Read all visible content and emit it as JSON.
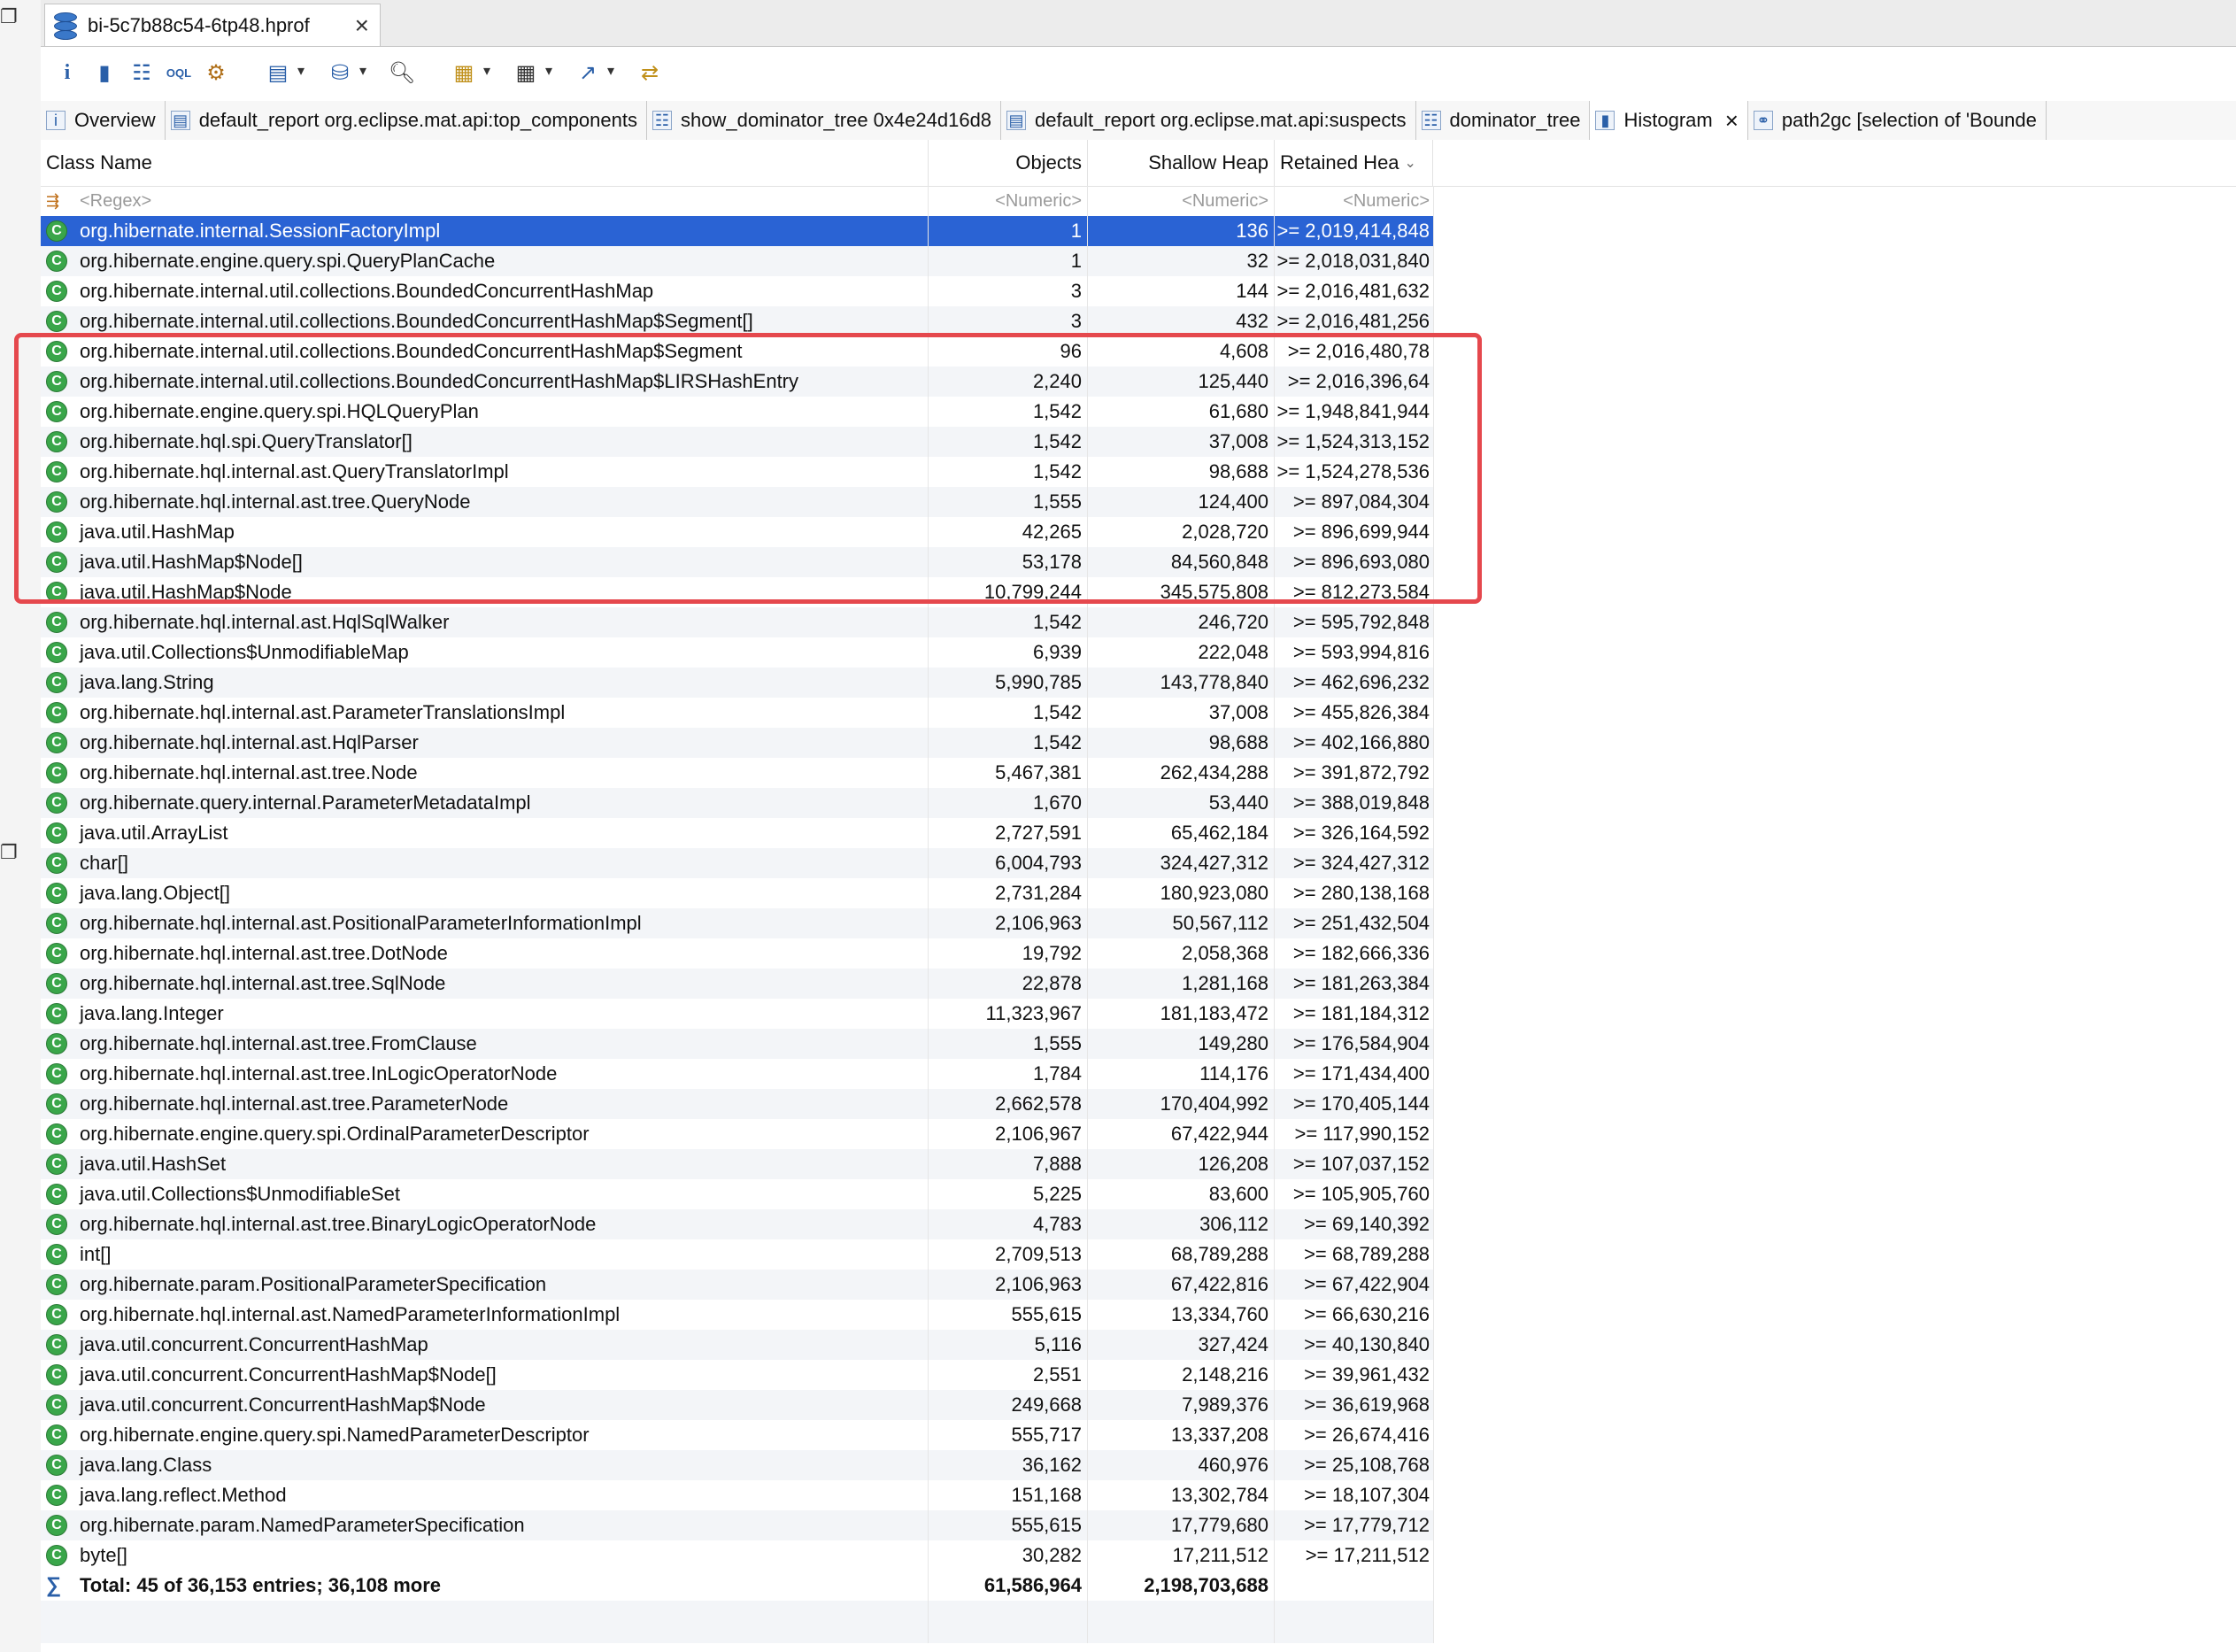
{
  "file_tab": {
    "title": "bi-5c7b88c54-6tp48.hprof"
  },
  "view_tabs": [
    {
      "label": "Overview",
      "icon": "info-icon"
    },
    {
      "label": "default_report org.eclipse.mat.api:top_components",
      "icon": "report-icon"
    },
    {
      "label": "show_dominator_tree 0x4e24d16d8",
      "icon": "tree-icon"
    },
    {
      "label": "default_report org.eclipse.mat.api:suspects",
      "icon": "report-icon"
    },
    {
      "label": "dominator_tree",
      "icon": "tree-icon"
    },
    {
      "label": "Histogram",
      "icon": "histogram-icon",
      "active": true
    },
    {
      "label": "path2gc [selection of 'Bounde",
      "icon": "path-icon"
    }
  ],
  "columns": {
    "class_name": "Class Name",
    "objects": "Objects",
    "shallow_heap": "Shallow Heap",
    "retained_heap": "Retained Hea"
  },
  "filter_row": {
    "name": "<Regex>",
    "objects": "<Numeric>",
    "shallow": "<Numeric>",
    "retained": "<Numeric>"
  },
  "rows": [
    [
      "org.hibernate.internal.SessionFactoryImpl",
      "1",
      "136",
      ">= 2,019,414,848"
    ],
    [
      "org.hibernate.engine.query.spi.QueryPlanCache",
      "1",
      "32",
      ">= 2,018,031,840"
    ],
    [
      "org.hibernate.internal.util.collections.BoundedConcurrentHashMap",
      "3",
      "144",
      ">= 2,016,481,632"
    ],
    [
      "org.hibernate.internal.util.collections.BoundedConcurrentHashMap$Segment[]",
      "3",
      "432",
      ">= 2,016,481,256"
    ],
    [
      "org.hibernate.internal.util.collections.BoundedConcurrentHashMap$Segment",
      "96",
      "4,608",
      ">= 2,016,480,78"
    ],
    [
      "org.hibernate.internal.util.collections.BoundedConcurrentHashMap$LIRSHashEntry",
      "2,240",
      "125,440",
      ">= 2,016,396,64"
    ],
    [
      "org.hibernate.engine.query.spi.HQLQueryPlan",
      "1,542",
      "61,680",
      ">= 1,948,841,944"
    ],
    [
      "org.hibernate.hql.spi.QueryTranslator[]",
      "1,542",
      "37,008",
      ">= 1,524,313,152"
    ],
    [
      "org.hibernate.hql.internal.ast.QueryTranslatorImpl",
      "1,542",
      "98,688",
      ">= 1,524,278,536"
    ],
    [
      "org.hibernate.hql.internal.ast.tree.QueryNode",
      "1,555",
      "124,400",
      ">= 897,084,304"
    ],
    [
      "java.util.HashMap",
      "42,265",
      "2,028,720",
      ">= 896,699,944"
    ],
    [
      "java.util.HashMap$Node[]",
      "53,178",
      "84,560,848",
      ">= 896,693,080"
    ],
    [
      "java.util.HashMap$Node",
      "10,799,244",
      "345,575,808",
      ">= 812,273,584"
    ],
    [
      "org.hibernate.hql.internal.ast.HqlSqlWalker",
      "1,542",
      "246,720",
      ">= 595,792,848"
    ],
    [
      "java.util.Collections$UnmodifiableMap",
      "6,939",
      "222,048",
      ">= 593,994,816"
    ],
    [
      "java.lang.String",
      "5,990,785",
      "143,778,840",
      ">= 462,696,232"
    ],
    [
      "org.hibernate.hql.internal.ast.ParameterTranslationsImpl",
      "1,542",
      "37,008",
      ">= 455,826,384"
    ],
    [
      "org.hibernate.hql.internal.ast.HqlParser",
      "1,542",
      "98,688",
      ">= 402,166,880"
    ],
    [
      "org.hibernate.hql.internal.ast.tree.Node",
      "5,467,381",
      "262,434,288",
      ">= 391,872,792"
    ],
    [
      "org.hibernate.query.internal.ParameterMetadataImpl",
      "1,670",
      "53,440",
      ">= 388,019,848"
    ],
    [
      "java.util.ArrayList",
      "2,727,591",
      "65,462,184",
      ">= 326,164,592"
    ],
    [
      "char[]",
      "6,004,793",
      "324,427,312",
      ">= 324,427,312"
    ],
    [
      "java.lang.Object[]",
      "2,731,284",
      "180,923,080",
      ">= 280,138,168"
    ],
    [
      "org.hibernate.hql.internal.ast.PositionalParameterInformationImpl",
      "2,106,963",
      "50,567,112",
      ">= 251,432,504"
    ],
    [
      "org.hibernate.hql.internal.ast.tree.DotNode",
      "19,792",
      "2,058,368",
      ">= 182,666,336"
    ],
    [
      "org.hibernate.hql.internal.ast.tree.SqlNode",
      "22,878",
      "1,281,168",
      ">= 181,263,384"
    ],
    [
      "java.lang.Integer",
      "11,323,967",
      "181,183,472",
      ">= 181,184,312"
    ],
    [
      "org.hibernate.hql.internal.ast.tree.FromClause",
      "1,555",
      "149,280",
      ">= 176,584,904"
    ],
    [
      "org.hibernate.hql.internal.ast.tree.InLogicOperatorNode",
      "1,784",
      "114,176",
      ">= 171,434,400"
    ],
    [
      "org.hibernate.hql.internal.ast.tree.ParameterNode",
      "2,662,578",
      "170,404,992",
      ">= 170,405,144"
    ],
    [
      "org.hibernate.engine.query.spi.OrdinalParameterDescriptor",
      "2,106,967",
      "67,422,944",
      ">= 117,990,152"
    ],
    [
      "java.util.HashSet",
      "7,888",
      "126,208",
      ">= 107,037,152"
    ],
    [
      "java.util.Collections$UnmodifiableSet",
      "5,225",
      "83,600",
      ">= 105,905,760"
    ],
    [
      "org.hibernate.hql.internal.ast.tree.BinaryLogicOperatorNode",
      "4,783",
      "306,112",
      ">= 69,140,392"
    ],
    [
      "int[]",
      "2,709,513",
      "68,789,288",
      ">= 68,789,288"
    ],
    [
      "org.hibernate.param.PositionalParameterSpecification",
      "2,106,963",
      "67,422,816",
      ">= 67,422,904"
    ],
    [
      "org.hibernate.hql.internal.ast.NamedParameterInformationImpl",
      "555,615",
      "13,334,760",
      ">= 66,630,216"
    ],
    [
      "java.util.concurrent.ConcurrentHashMap",
      "5,116",
      "327,424",
      ">= 40,130,840"
    ],
    [
      "java.util.concurrent.ConcurrentHashMap$Node[]",
      "2,551",
      "2,148,216",
      ">= 39,961,432"
    ],
    [
      "java.util.concurrent.ConcurrentHashMap$Node",
      "249,668",
      "7,989,376",
      ">= 36,619,968"
    ],
    [
      "org.hibernate.engine.query.spi.NamedParameterDescriptor",
      "555,717",
      "13,337,208",
      ">= 26,674,416"
    ],
    [
      "java.lang.Class",
      "36,162",
      "460,976",
      ">= 25,108,768"
    ],
    [
      "java.lang.reflect.Method",
      "151,168",
      "13,302,784",
      ">= 18,107,304"
    ],
    [
      "org.hibernate.param.NamedParameterSpecification",
      "555,615",
      "17,779,680",
      ">= 17,779,712"
    ],
    [
      "byte[]",
      "30,282",
      "17,211,512",
      ">= 17,211,512"
    ]
  ],
  "total": {
    "label": "Total: 45 of 36,153 entries; 36,108 more",
    "objects": "61,586,964",
    "shallow": "2,198,703,688"
  },
  "selected_index": 0,
  "colors": {
    "selection": "#2a63d4",
    "class_icon": "#3aa64a",
    "highlight_box": "#e5484d"
  }
}
